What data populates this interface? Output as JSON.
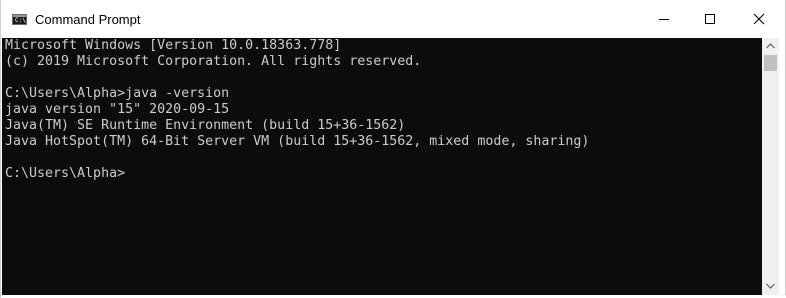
{
  "window": {
    "title": "Command Prompt",
    "app_icon": "cmd-icon",
    "app_icon_glyph": "C:\\",
    "controls": {
      "minimize_icon": "minimize-icon",
      "maximize_icon": "maximize-icon",
      "close_icon": "close-icon"
    }
  },
  "console": {
    "background": "#0c0c0c",
    "foreground": "#cccccc",
    "lines": [
      "Microsoft Windows [Version 10.0.18363.778]",
      "(c) 2019 Microsoft Corporation. All rights reserved.",
      "",
      "C:\\Users\\Alpha>java -version",
      "java version \"15\" 2020-09-15",
      "Java(TM) SE Runtime Environment (build 15+36-1562)",
      "Java HotSpot(TM) 64-Bit Server VM (build 15+36-1562, mixed mode, sharing)",
      "",
      "C:\\Users\\Alpha>"
    ]
  },
  "scrollbar": {
    "up_icon": "scroll-up-arrow-icon",
    "down_icon": "scroll-down-arrow-icon"
  }
}
